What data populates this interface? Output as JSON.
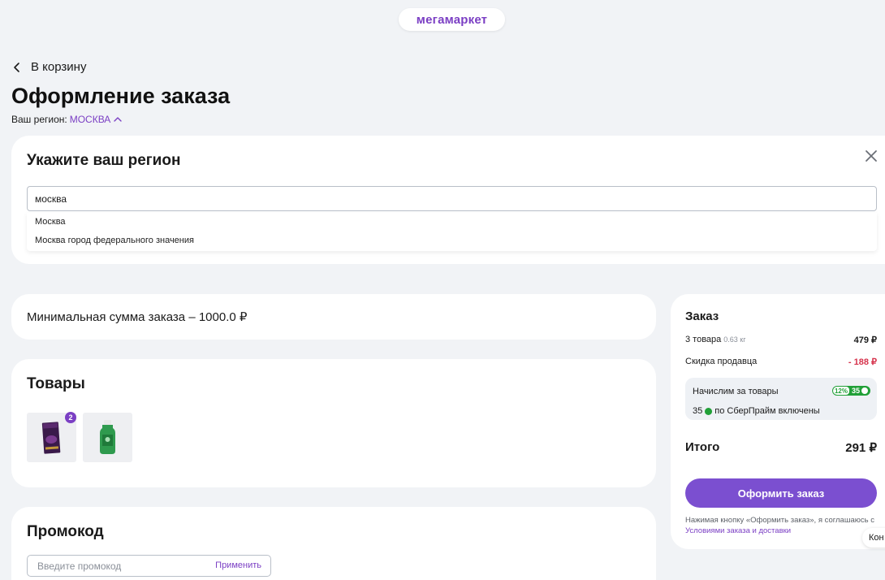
{
  "header": {
    "logo": "мегамаркет"
  },
  "nav": {
    "back_label": "В корзину"
  },
  "page": {
    "title": "Оформление заказа",
    "region_label": "Ваш регион:",
    "region_value": "МОСКВА"
  },
  "region_picker": {
    "title": "Укажите ваш регион",
    "input_value": "москва",
    "suggestions": [
      "Москва",
      "Москва город федерального значения"
    ]
  },
  "min_order": {
    "text": "Минимальная сумма заказа – 1000.0 ₽"
  },
  "goods": {
    "title": "Товары",
    "items": [
      {
        "name": "chocolate",
        "count": "2"
      },
      {
        "name": "bottle"
      }
    ]
  },
  "promo": {
    "title": "Промокод",
    "placeholder": "Введите промокод",
    "apply_label": "Применить"
  },
  "order": {
    "title": "Заказ",
    "items_label": "3 товара",
    "weight": "0.63 кг",
    "items_sum": "479 ₽",
    "discount_label": "Скидка продавца",
    "discount_value": "- 188 ₽",
    "bonus_label": "Начислим за товары",
    "bonus_pct": "12%",
    "bonus_amount": "35",
    "bonus_prime_amount": "35",
    "bonus_prime_text": "по СберПрайм включены",
    "total_label": "Итого",
    "total_value": "291 ₽",
    "submit_label": "Оформить заказ",
    "legal_prefix": "Нажимая кнопку «Оформить заказ», я соглашаюсь с ",
    "legal_link": "Условиями заказа и доставки"
  },
  "chat": {
    "label": "Кон"
  },
  "colors": {
    "accent": "#7b3fc4",
    "button": "#7b4fd0",
    "discount": "#d6334c",
    "sber_green": "#21a038",
    "background": "#f1f3f6"
  }
}
